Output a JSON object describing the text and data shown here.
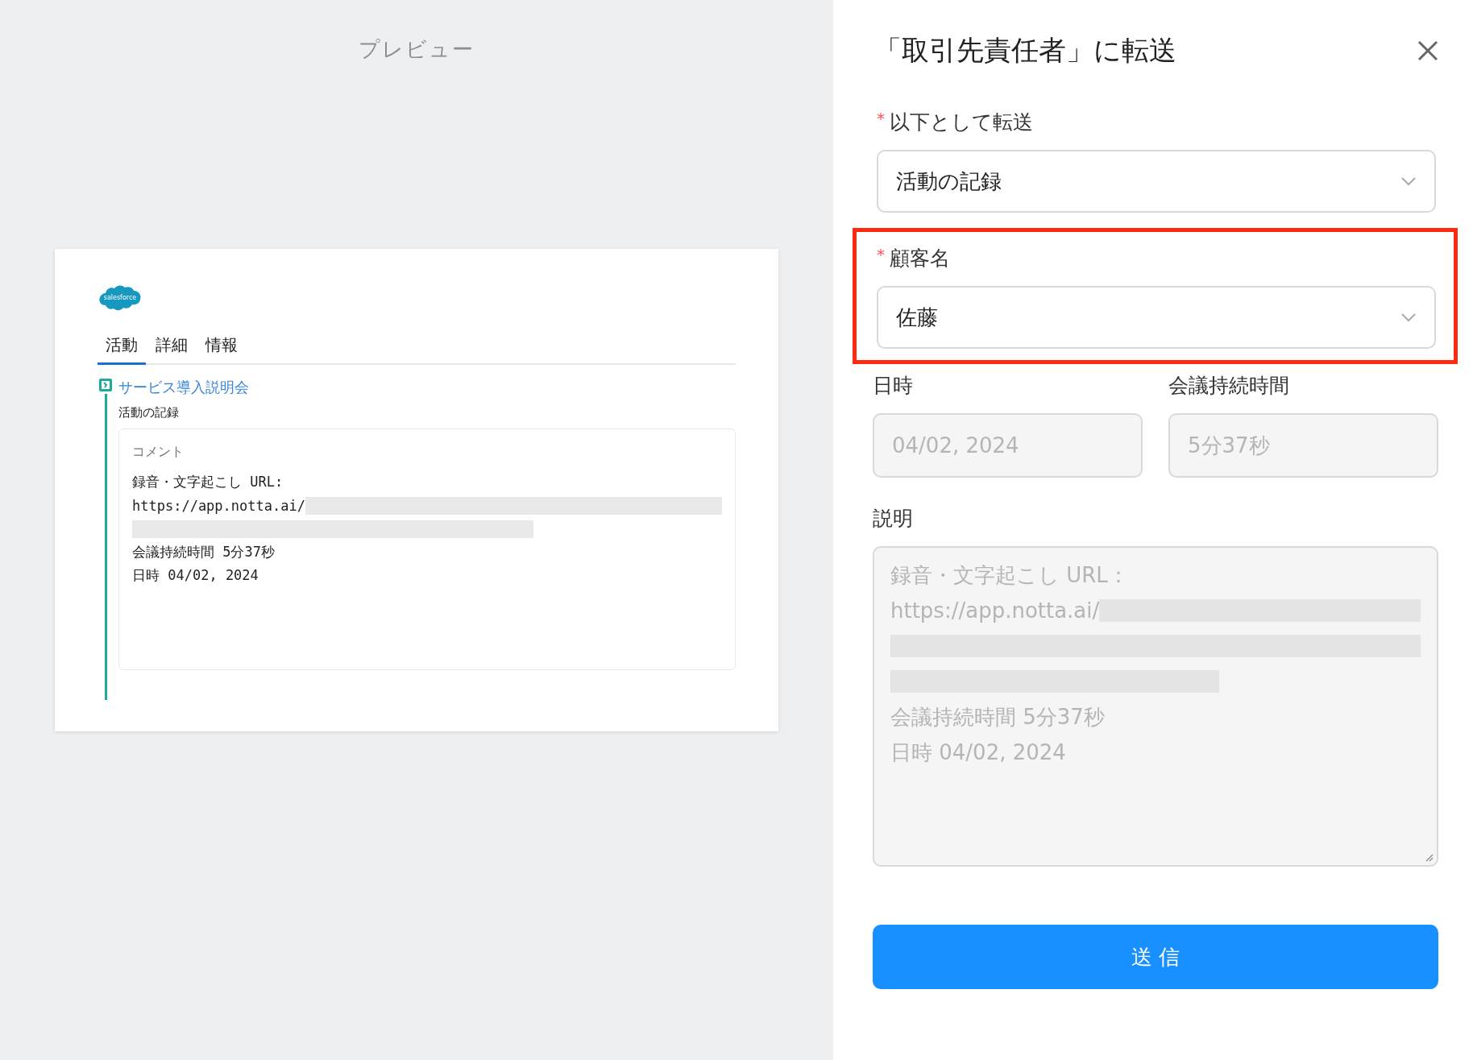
{
  "preview": {
    "title": "プレビュー",
    "card": {
      "logo": "salesforce",
      "tabs": [
        {
          "label": "活動",
          "selected": true
        },
        {
          "label": "詳細",
          "selected": false
        },
        {
          "label": "情報",
          "selected": false
        }
      ],
      "activity": {
        "title": "サービス導入説明会",
        "subtitle": "活動の記録",
        "comment": {
          "heading": "コメント",
          "lines": [
            {
              "kind": "text",
              "text": "録音・文字起こし URL:"
            },
            {
              "kind": "link",
              "text": "https://app.notta.ai/"
            },
            {
              "kind": "redacted"
            },
            {
              "kind": "text",
              "text": "会議持続時間 5分37秒"
            },
            {
              "kind": "text",
              "text": "日時 04/02, 2024"
            }
          ]
        }
      }
    }
  },
  "panel": {
    "title": "「取引先責任者」に転送",
    "fields": [
      {
        "label": "以下として転送",
        "required_mark": "*",
        "value": "活動の記録",
        "highlighted": false
      },
      {
        "label": "顧客名",
        "required_mark": "*",
        "value": "佐藤",
        "highlighted": true
      }
    ],
    "row": [
      {
        "label": "日時",
        "value": "04/02, 2024",
        "disabled": true
      },
      {
        "label": "会議持続時間",
        "value": "5分37秒",
        "disabled": true
      }
    ],
    "description": {
      "label": "説明",
      "disabled": true,
      "lines": [
        {
          "kind": "text",
          "text": "録音・文字起こし URL："
        },
        {
          "kind": "link",
          "text": "https://app.notta.ai/"
        },
        {
          "kind": "redacted"
        },
        {
          "kind": "redacted_short"
        },
        {
          "kind": "text",
          "text": "会議持続時間 5分37秒"
        },
        {
          "kind": "text",
          "text": "日時 04/02, 2024"
        }
      ]
    },
    "submit": "送 信"
  }
}
